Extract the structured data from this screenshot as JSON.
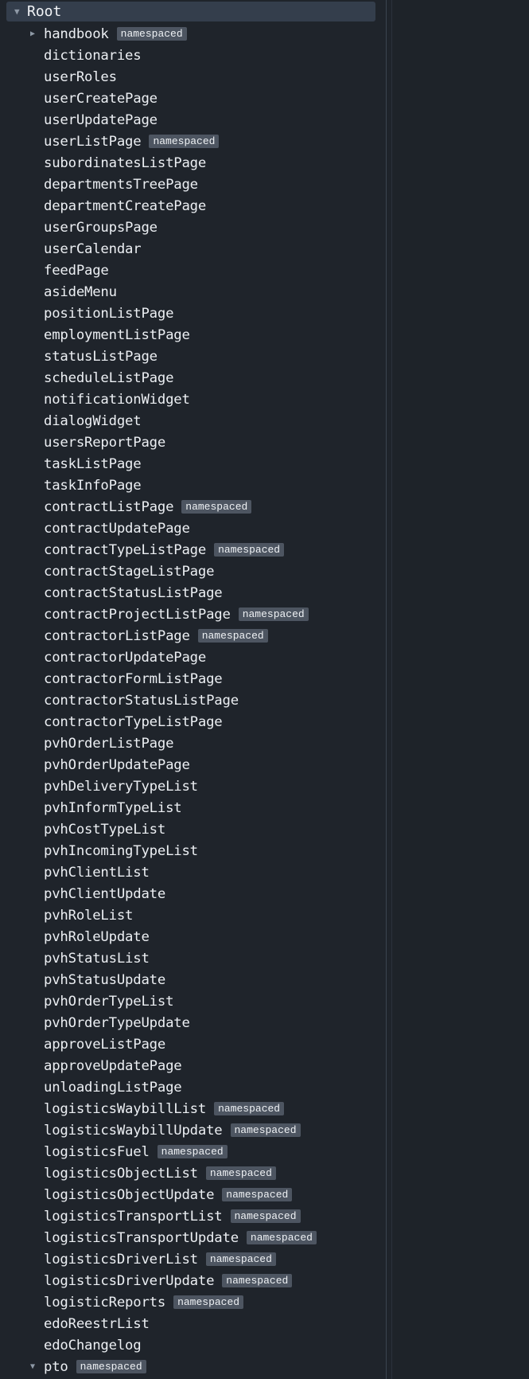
{
  "root": {
    "label": "Root",
    "expanded": true,
    "caret_icon": "caret-down-icon"
  },
  "badge_text": "namespaced",
  "items": [
    {
      "label": "handbook",
      "namespaced": true,
      "caret": "right"
    },
    {
      "label": "dictionaries"
    },
    {
      "label": "userRoles"
    },
    {
      "label": "userCreatePage"
    },
    {
      "label": "userUpdatePage"
    },
    {
      "label": "userListPage",
      "namespaced": true
    },
    {
      "label": "subordinatesListPage"
    },
    {
      "label": "departmentsTreePage"
    },
    {
      "label": "departmentCreatePage"
    },
    {
      "label": "userGroupsPage"
    },
    {
      "label": "userCalendar"
    },
    {
      "label": "feedPage"
    },
    {
      "label": "asideMenu"
    },
    {
      "label": "positionListPage"
    },
    {
      "label": "employmentListPage"
    },
    {
      "label": "statusListPage"
    },
    {
      "label": "scheduleListPage"
    },
    {
      "label": "notificationWidget"
    },
    {
      "label": "dialogWidget"
    },
    {
      "label": "usersReportPage"
    },
    {
      "label": "taskListPage"
    },
    {
      "label": "taskInfoPage"
    },
    {
      "label": "contractListPage",
      "namespaced": true
    },
    {
      "label": "contractUpdatePage"
    },
    {
      "label": "contractTypeListPage",
      "namespaced": true
    },
    {
      "label": "contractStageListPage"
    },
    {
      "label": "contractStatusListPage"
    },
    {
      "label": "contractProjectListPage",
      "namespaced": true
    },
    {
      "label": "contractorListPage",
      "namespaced": true
    },
    {
      "label": "contractorUpdatePage"
    },
    {
      "label": "contractorFormListPage"
    },
    {
      "label": "contractorStatusListPage"
    },
    {
      "label": "contractorTypeListPage"
    },
    {
      "label": "pvhOrderListPage"
    },
    {
      "label": "pvhOrderUpdatePage"
    },
    {
      "label": "pvhDeliveryTypeList"
    },
    {
      "label": "pvhInformTypeList"
    },
    {
      "label": "pvhCostTypeList"
    },
    {
      "label": "pvhIncomingTypeList"
    },
    {
      "label": "pvhClientList"
    },
    {
      "label": "pvhClientUpdate"
    },
    {
      "label": "pvhRoleList"
    },
    {
      "label": "pvhRoleUpdate"
    },
    {
      "label": "pvhStatusList"
    },
    {
      "label": "pvhStatusUpdate"
    },
    {
      "label": "pvhOrderTypeList"
    },
    {
      "label": "pvhOrderTypeUpdate"
    },
    {
      "label": "approveListPage"
    },
    {
      "label": "approveUpdatePage"
    },
    {
      "label": "unloadingListPage"
    },
    {
      "label": "logisticsWaybillList",
      "namespaced": true
    },
    {
      "label": "logisticsWaybillUpdate",
      "namespaced": true
    },
    {
      "label": "logisticsFuel",
      "namespaced": true
    },
    {
      "label": "logisticsObjectList",
      "namespaced": true
    },
    {
      "label": "logisticsObjectUpdate",
      "namespaced": true
    },
    {
      "label": "logisticsTransportList",
      "namespaced": true
    },
    {
      "label": "logisticsTransportUpdate",
      "namespaced": true
    },
    {
      "label": "logisticsDriverList",
      "namespaced": true
    },
    {
      "label": "logisticsDriverUpdate",
      "namespaced": true
    },
    {
      "label": "logisticReports",
      "namespaced": true
    },
    {
      "label": "edoReestrList"
    },
    {
      "label": "edoChangelog"
    },
    {
      "label": "pto",
      "namespaced": true,
      "caret": "down"
    }
  ],
  "colors": {
    "background": "#1f242b",
    "selected_row": "#343e4c",
    "badge_bg": "#4d5561",
    "text": "#eceff3",
    "caret": "#8e99a6"
  }
}
